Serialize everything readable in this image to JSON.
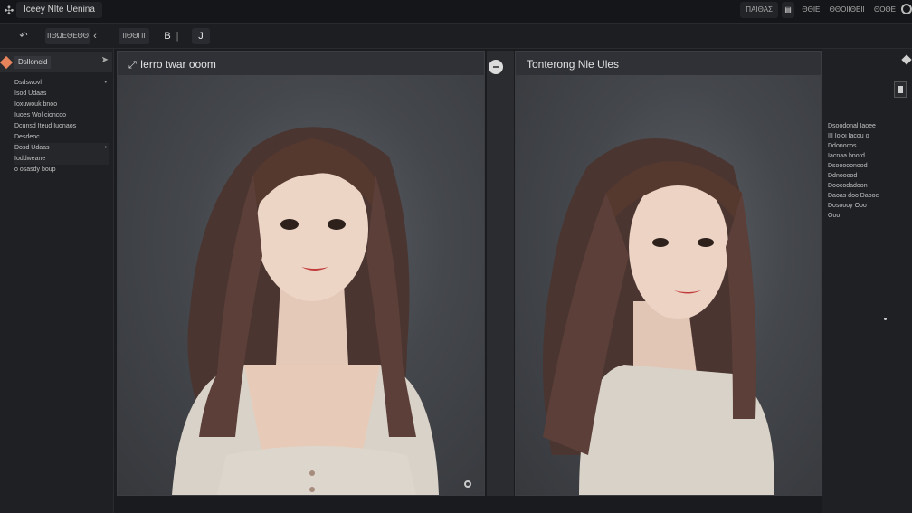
{
  "titlebar": {
    "app_title": "Iceey Nlte Uenina",
    "right_button": "ΠΑΙΘΑΣ",
    "right_button_icon": "doc-icon",
    "links": [
      "ΘΘΙΕ",
      "ΘΘΟΙΙΘΕΙΙ",
      "ΘΟΘΕ"
    ]
  },
  "toolbar": {
    "undo_icon": "undo-icon",
    "dropdown_label": "ΙΙΘΩΕΘΕΘΘ",
    "back_glyph": "‹",
    "small_button": "ΙΙΘΘΠΙ",
    "b_label": "Β",
    "j_label": "J"
  },
  "sidebar": {
    "header": "Dslloncid",
    "items": [
      {
        "label": "Dsdswovl"
      },
      {
        "label": "Isod Udaas"
      },
      {
        "label": "Ioxuwouk bnoo"
      },
      {
        "label": "Iuoes Wol cioncoo"
      },
      {
        "label": "Dcunsd Iteud Iuonaos"
      },
      {
        "label": "Desdeoc"
      },
      {
        "label": "Dosd Udaas"
      },
      {
        "label": "Ioddweane"
      },
      {
        "label": "o osasdy boup"
      }
    ]
  },
  "left_panel": {
    "title": "Ierro twar ooom"
  },
  "right_panel": {
    "title": "Tonterong Nle Ules"
  },
  "right_sidebar": {
    "items": [
      "Dsoodonal Iaoee",
      "ΙΙΙ Ιοιοι Iacou o",
      "Ddonocos",
      "Iacnaa bnord",
      "Dsooooonood",
      "Ddnooood",
      "Doocodadoon",
      "Daoas doo Daooe",
      "Dosoooy Ooo",
      "Ooo"
    ]
  },
  "colors": {
    "accent": "#e8845c",
    "background": "#1b1c1f",
    "panel": "#2f3136"
  }
}
